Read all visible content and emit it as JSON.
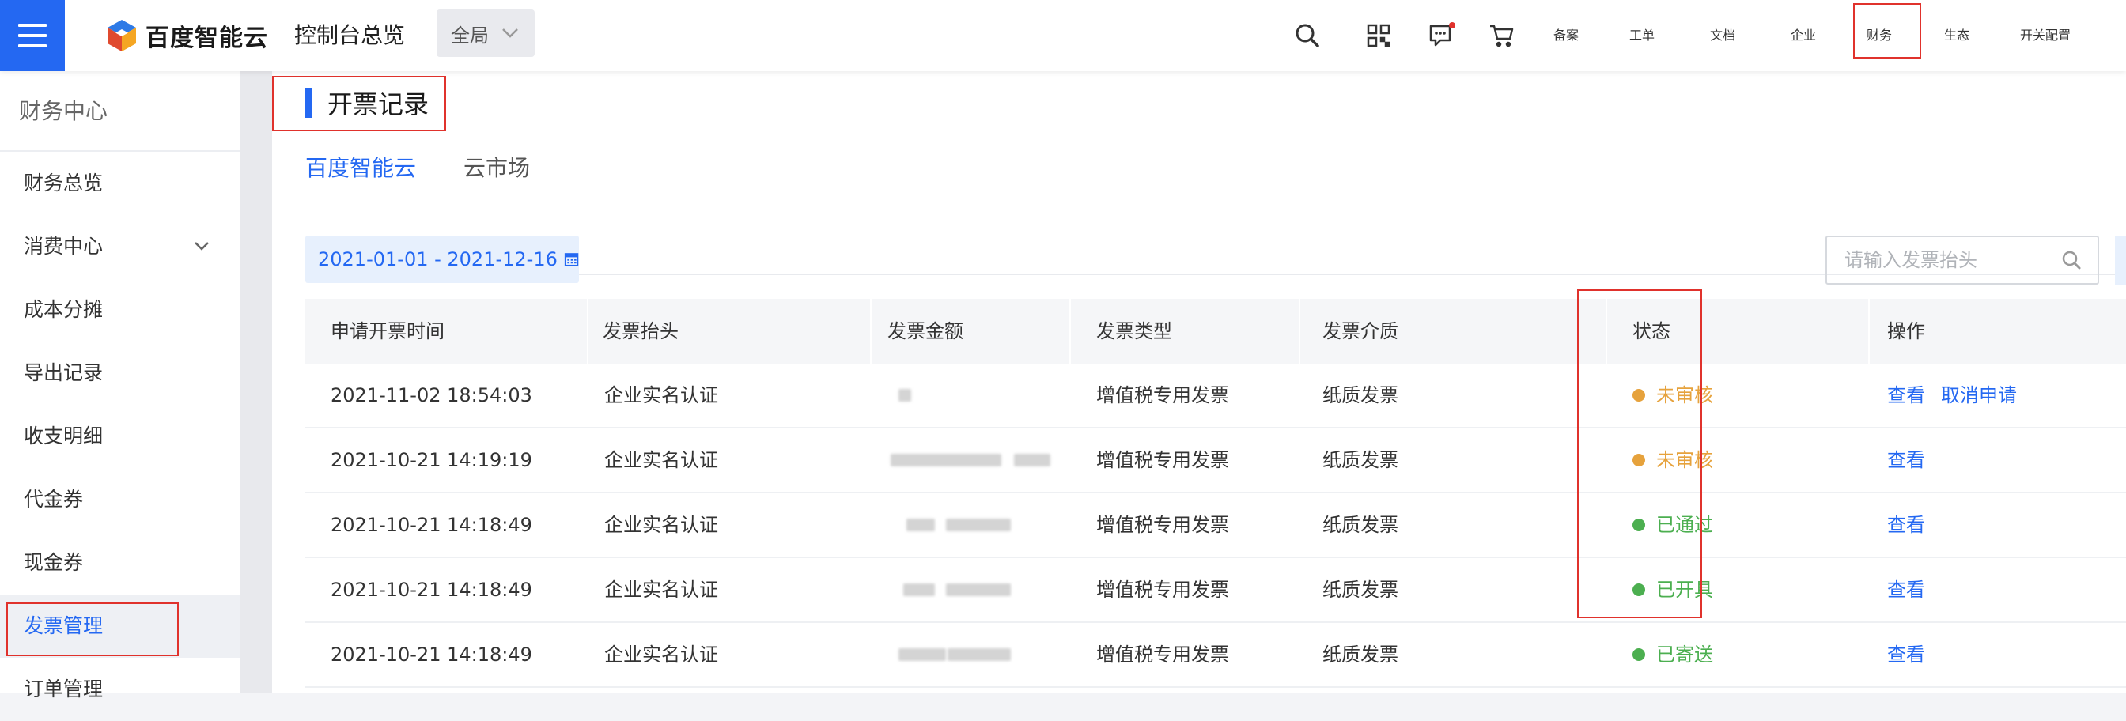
{
  "header": {
    "logo_text": "百度智能云",
    "console_title": "控制台总览",
    "scope": "全局",
    "nav": [
      "备案",
      "工单",
      "文档",
      "企业",
      "财务",
      "生态",
      "开关配置"
    ],
    "active_nav": "财务",
    "icons": [
      "search-icon",
      "qr-code-icon",
      "message-icon",
      "cart-icon"
    ],
    "accent": "#2468f2",
    "highlight": "#e0322c"
  },
  "sidebar": {
    "title": "财务中心",
    "items": [
      "财务总览",
      "消费中心",
      "成本分摊",
      "导出记录",
      "收支明细",
      "代金券",
      "现金券",
      "发票管理",
      "订单管理"
    ],
    "active": "发票管理"
  },
  "main": {
    "title": "开票记录",
    "tabs": [
      "百度智能云",
      "云市场"
    ],
    "active_tab": "百度智能云",
    "date_range": "2021-01-01 - 2021-12-16",
    "search_placeholder": "请输入发票抬头"
  },
  "table": {
    "columns": [
      "申请开票时间",
      "发票抬头",
      "发票金额",
      "发票类型",
      "发票介质",
      "状态",
      "操作"
    ],
    "rows": [
      {
        "time": "2021-11-02 18:54:03",
        "title": "企业实名认证",
        "type": "增值税专用发票",
        "medium": "纸质发票",
        "status": "未审核",
        "status_color": "#e6a23c",
        "actions": [
          "查看",
          "取消申请"
        ]
      },
      {
        "time": "2021-10-21 14:19:19",
        "title": "企业实名认证",
        "type": "增值税专用发票",
        "medium": "纸质发票",
        "status": "未审核",
        "status_color": "#e6a23c",
        "actions": [
          "查看"
        ]
      },
      {
        "time": "2021-10-21 14:18:49",
        "title": "企业实名认证",
        "type": "增值税专用发票",
        "medium": "纸质发票",
        "status": "已通过",
        "status_color": "#4caf50",
        "actions": [
          "查看"
        ]
      },
      {
        "time": "2021-10-21 14:18:49",
        "title": "企业实名认证",
        "type": "增值税专用发票",
        "medium": "纸质发票",
        "status": "已开具",
        "status_color": "#4caf50",
        "actions": [
          "查看"
        ]
      },
      {
        "time": "2021-10-21 14:18:49",
        "title": "企业实名认证",
        "type": "增值税专用发票",
        "medium": "纸质发票",
        "status": "已寄送",
        "status_color": "#4caf50",
        "actions": [
          "查看"
        ]
      }
    ]
  }
}
